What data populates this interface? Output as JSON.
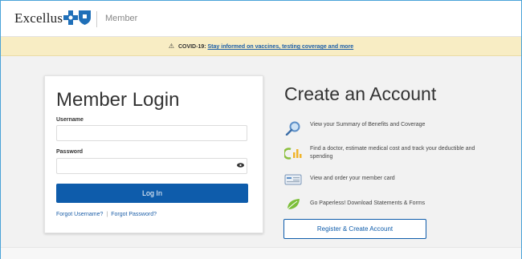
{
  "header": {
    "brand": "Excellus",
    "member_tab": "Member"
  },
  "alert": {
    "prefix": "COVID-19:",
    "link": "Stay informed on vaccines, testing coverage and more"
  },
  "login": {
    "title": "Member Login",
    "username_label": "Username",
    "username_value": "",
    "password_label": "Password",
    "password_value": "",
    "submit_label": "Log In",
    "forgot_username": "Forgot Username?",
    "separator": "|",
    "forgot_password": "Forgot Password?"
  },
  "create": {
    "title": "Create an Account",
    "features": [
      {
        "icon": "magnifier-icon",
        "text": "View your Summary of Benefits and Coverage"
      },
      {
        "icon": "chart-icon",
        "text": "Find a doctor, estimate medical cost and track your deductible and spending"
      },
      {
        "icon": "member-card-icon",
        "text": "View and order your member card"
      },
      {
        "icon": "leaf-icon",
        "text": "Go Paperless! Download Statements & Forms"
      }
    ],
    "register_label": "Register & Create Account"
  },
  "colors": {
    "primary": "#0e5cab",
    "alert_bg": "#f8edc4",
    "logo_blue": "#1f6fb8"
  }
}
